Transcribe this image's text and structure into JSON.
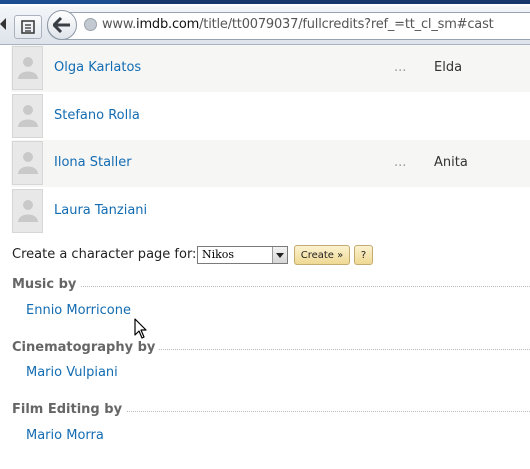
{
  "browser": {
    "url_prefix": "www.",
    "url_domain": "imdb.com",
    "url_path": "/title/tt0079037/fullcredits?ref_=tt_cl_sm#cast"
  },
  "cast": [
    {
      "actor": "Olga Karlatos",
      "ellipsis": "...",
      "character": "Elda"
    },
    {
      "actor": "Stefano Rolla",
      "ellipsis": "",
      "character": ""
    },
    {
      "actor": "Ilona Staller",
      "ellipsis": "...",
      "character": "Anita"
    },
    {
      "actor": "Laura Tanziani",
      "ellipsis": "",
      "character": ""
    }
  ],
  "character_page": {
    "label": "Create a character page for:",
    "selected": "Nikos",
    "create_label": "Create »",
    "help_label": "?"
  },
  "sections": [
    {
      "title": "Music by",
      "names": [
        "Ennio Morricone"
      ]
    },
    {
      "title": "Cinematography by",
      "names": [
        "Mario Vulpiani"
      ]
    },
    {
      "title": "Film Editing by",
      "names": [
        "Mario Morra"
      ]
    }
  ]
}
